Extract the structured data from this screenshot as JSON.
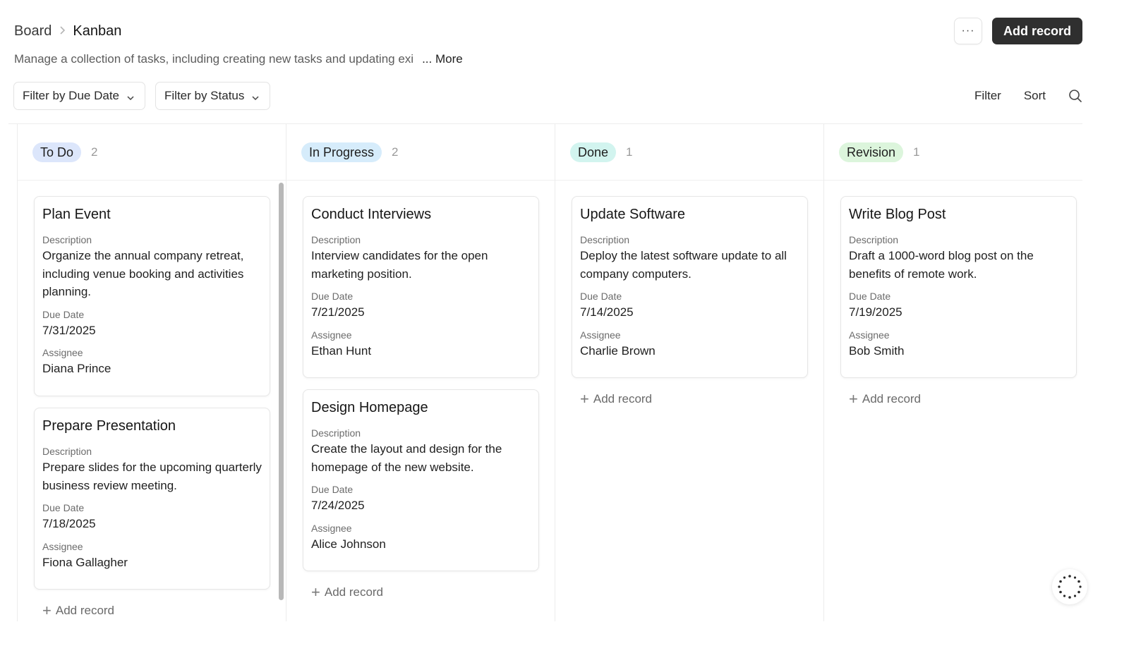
{
  "header": {
    "breadcrumb_root": "Board",
    "breadcrumb_current": "Kanban",
    "more_label": "···",
    "add_record_label": "Add record"
  },
  "description": {
    "text": "Manage a collection of tasks, including creating new tasks and updating exi",
    "more_label": "... More"
  },
  "filters": {
    "due_date_label": "Filter by Due Date",
    "status_label": "Filter by Status",
    "filter_label": "Filter",
    "sort_label": "Sort"
  },
  "labels": {
    "description": "Description",
    "due_date": "Due Date",
    "assignee": "Assignee",
    "add_record": "Add record"
  },
  "colors": {
    "todo": "#dce6fb",
    "in_progress": "#d6ecfb",
    "done": "#d2f4ef",
    "revision": "#dcf5dc"
  },
  "columns": [
    {
      "name": "To Do",
      "count": "2",
      "cards": [
        {
          "title": "Plan Event",
          "description": "Organize the annual company retreat, including venue booking and activities planning.",
          "due_date": "7/31/2025",
          "assignee": "Diana Prince"
        },
        {
          "title": "Prepare Presentation",
          "description": "Prepare slides for the upcoming quarterly business review meeting.",
          "due_date": "7/18/2025",
          "assignee": "Fiona Gallagher"
        }
      ]
    },
    {
      "name": "In Progress",
      "count": "2",
      "cards": [
        {
          "title": "Conduct Interviews",
          "description": "Interview candidates for the open marketing position.",
          "due_date": "7/21/2025",
          "assignee": "Ethan Hunt"
        },
        {
          "title": "Design Homepage",
          "description": "Create the layout and design for the homepage of the new website.",
          "due_date": "7/24/2025",
          "assignee": "Alice Johnson"
        }
      ]
    },
    {
      "name": "Done",
      "count": "1",
      "cards": [
        {
          "title": "Update Software",
          "description": "Deploy the latest software update to all company computers.",
          "due_date": "7/14/2025",
          "assignee": "Charlie Brown"
        }
      ]
    },
    {
      "name": "Revision",
      "count": "1",
      "cards": [
        {
          "title": "Write Blog Post",
          "description": "Draft a 1000-word blog post on the benefits of remote work.",
          "due_date": "7/19/2025",
          "assignee": "Bob Smith"
        }
      ]
    }
  ]
}
